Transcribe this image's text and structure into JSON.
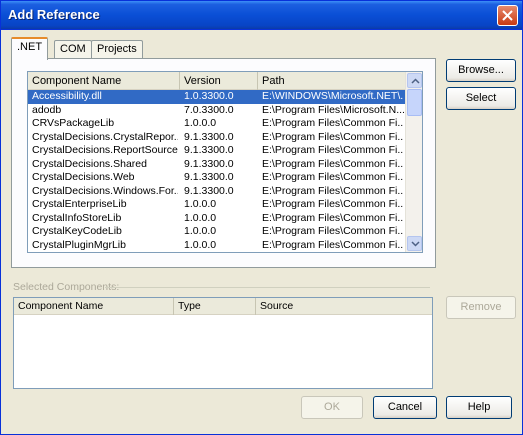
{
  "window": {
    "title": "Add Reference"
  },
  "tabs": [
    {
      "label": ".NET"
    },
    {
      "label": "COM"
    },
    {
      "label": "Projects"
    }
  ],
  "components": {
    "columns": [
      "Component Name",
      "Version",
      "Path"
    ],
    "rows": [
      {
        "name": "Accessibility.dll",
        "version": "1.0.3300.0",
        "path": "E:\\WINDOWS\\Microsoft.NET\\...",
        "selected": true
      },
      {
        "name": "adodb",
        "version": "7.0.3300.0",
        "path": "E:\\Program Files\\Microsoft.N..."
      },
      {
        "name": "CRVsPackageLib",
        "version": "1.0.0.0",
        "path": "E:\\Program Files\\Common Fi..."
      },
      {
        "name": "CrystalDecisions.CrystalRepor...",
        "version": "9.1.3300.0",
        "path": "E:\\Program Files\\Common Fi..."
      },
      {
        "name": "CrystalDecisions.ReportSource",
        "version": "9.1.3300.0",
        "path": "E:\\Program Files\\Common Fi..."
      },
      {
        "name": "CrystalDecisions.Shared",
        "version": "9.1.3300.0",
        "path": "E:\\Program Files\\Common Fi..."
      },
      {
        "name": "CrystalDecisions.Web",
        "version": "9.1.3300.0",
        "path": "E:\\Program Files\\Common Fi..."
      },
      {
        "name": "CrystalDecisions.Windows.For...",
        "version": "9.1.3300.0",
        "path": "E:\\Program Files\\Common Fi..."
      },
      {
        "name": "CrystalEnterpriseLib",
        "version": "1.0.0.0",
        "path": "E:\\Program Files\\Common Fi..."
      },
      {
        "name": "CrystalInfoStoreLib",
        "version": "1.0.0.0",
        "path": "E:\\Program Files\\Common Fi..."
      },
      {
        "name": "CrystalKeyCodeLib",
        "version": "1.0.0.0",
        "path": "E:\\Program Files\\Common Fi..."
      },
      {
        "name": "CrystalPluginMgrLib",
        "version": "1.0.0.0",
        "path": "E:\\Program Files\\Common Fi..."
      }
    ]
  },
  "buttons": {
    "browse": "Browse...",
    "select": "Select",
    "remove": "Remove",
    "ok": "OK",
    "cancel": "Cancel",
    "help": "Help"
  },
  "selected_components": {
    "label": "Selected Components:",
    "columns": [
      "Component Name",
      "Type",
      "Source"
    ]
  }
}
